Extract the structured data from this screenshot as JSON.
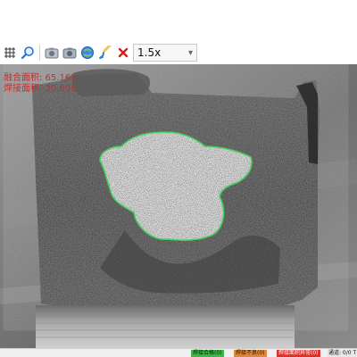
{
  "toolbar": {
    "zoom_value": "1.5x",
    "icons": [
      "grid-icon",
      "magnify-icon",
      "camera-icon",
      "camera-settings-icon",
      "globe-icon",
      "brush-icon",
      "close-icon"
    ]
  },
  "overlay": {
    "line1": "融合面积: 65.161",
    "line2": "焊接面积: 30.896"
  },
  "status": {
    "badge_green_1": "焊接合格(0)",
    "badge_orange": "焊接不良(0)",
    "badge_red": "焊接面积异常(0)",
    "badge_right": "通道: 0/0 T"
  },
  "colors": {
    "outline": "#43d15a",
    "overlay_text": "#b33333",
    "badge_green": "#3fb64a",
    "badge_orange": "#e0893c",
    "badge_red": "#d9322d"
  }
}
